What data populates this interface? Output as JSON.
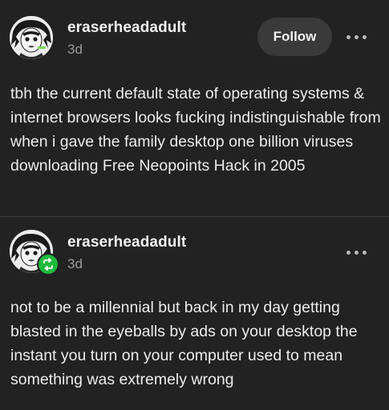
{
  "posts": [
    {
      "username": "eraserheadadult",
      "timestamp": "3d",
      "follow_label": "Follow",
      "more_icon": "ellipsis-icon",
      "avatar_icon": "avatar-illustration",
      "body": "tbh the current default state of operating systems & internet browsers looks fucking indistinguishable from when i gave the family desktop one billion viruses downloading Free Neopoints Hack in 2005"
    },
    {
      "username": "eraserheadadult",
      "timestamp": "3d",
      "more_icon": "ellipsis-icon",
      "avatar_icon": "avatar-illustration",
      "badge_icon": "reblog-icon",
      "body": "not to be a millennial but back in my day getting blasted in the eyeballs by ads on your desktop the instant you turn on your computer used to mean something was extremely wrong"
    }
  ],
  "colors": {
    "background": "#222222",
    "text": "#ececec",
    "muted": "#9a9a9a",
    "follow_bg": "#3a3a3a",
    "reblog_badge": "#1fba3c"
  }
}
